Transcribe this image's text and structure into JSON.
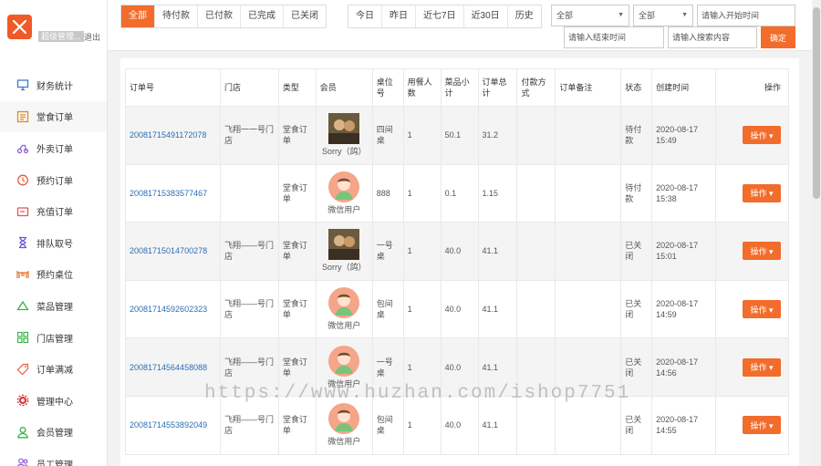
{
  "brand": {
    "user": "超级管理...",
    "logout": "退出"
  },
  "sidebar": {
    "items": [
      {
        "label": "财务统计",
        "icon": "monitor-icon",
        "color": "#3a7bd5"
      },
      {
        "label": "堂食订单",
        "icon": "list-icon",
        "color": "#e88b1c",
        "active": true
      },
      {
        "label": "外卖订单",
        "icon": "scooter-icon",
        "color": "#8e5ad8"
      },
      {
        "label": "预约订单",
        "icon": "clock-icon",
        "color": "#e85d3a"
      },
      {
        "label": "充值订单",
        "icon": "card-icon",
        "color": "#e84f4f"
      },
      {
        "label": "排队取号",
        "icon": "hourglass-icon",
        "color": "#6a4fd8"
      },
      {
        "label": "预约桌位",
        "icon": "table-icon",
        "color": "#e8702a"
      },
      {
        "label": "菜品管理",
        "icon": "cloud-icon",
        "color": "#3ab54a"
      },
      {
        "label": "门店管理",
        "icon": "grid-icon",
        "color": "#3ab54a"
      },
      {
        "label": "订单满减",
        "icon": "tag-icon",
        "color": "#e85d3a"
      },
      {
        "label": "管理中心",
        "icon": "gear-icon",
        "color": "#d83a3a"
      },
      {
        "label": "会员管理",
        "icon": "user-icon",
        "color": "#3ab54a"
      },
      {
        "label": "员工管理",
        "icon": "users-icon",
        "color": "#8e5ad8"
      }
    ]
  },
  "filters": {
    "status_tabs": [
      "全部",
      "待付款",
      "已付款",
      "已完成",
      "已关闭"
    ],
    "date_tabs": [
      "今日",
      "昨日",
      "近七7日",
      "近30日",
      "历史"
    ],
    "select1": "全部",
    "select2": "全部",
    "start_placeholder": "请输入开始时间",
    "end_placeholder": "请输入结束时间",
    "search_placeholder": "请输入搜索内容",
    "confirm": "确定"
  },
  "table": {
    "headers": [
      "订单号",
      "门店",
      "类型",
      "会员",
      "桌位号",
      "用餐人数",
      "菜品小计",
      "订单总计",
      "付款方式",
      "订单备注",
      "状态",
      "创建时间",
      "操作"
    ],
    "rows": [
      {
        "order_no": "20081715491172078",
        "store": "飞翔一一号门店",
        "type": "堂食订单",
        "member": "Sorry（鸽）",
        "avatar": "photo",
        "table": "四间桌",
        "people": "1",
        "subtotal": "50.1",
        "total": "31.2",
        "pay": "",
        "note": "",
        "status": "待付款",
        "date": "2020-08-17",
        "time": "15:49",
        "op": "操作"
      },
      {
        "order_no": "20081715383577467",
        "store": "",
        "type": "堂食订单",
        "member": "微信用户",
        "avatar": "default",
        "table": "888",
        "people": "1",
        "subtotal": "0.1",
        "total": "1.15",
        "pay": "",
        "note": "",
        "status": "待付款",
        "date": "2020-08-17",
        "time": "15:38",
        "op": "操作"
      },
      {
        "order_no": "20081715014700278",
        "store": "飞翔——号门店",
        "type": "堂食订单",
        "member": "Sorry（鸽）",
        "avatar": "photo",
        "table": "一号桌",
        "people": "1",
        "subtotal": "40.0",
        "total": "41.1",
        "pay": "",
        "note": "",
        "status": "已关闭",
        "date": "2020-08-17",
        "time": "15:01",
        "op": "操作"
      },
      {
        "order_no": "20081714592602323",
        "store": "飞翔——号门店",
        "type": "堂食订单",
        "member": "微信用户",
        "avatar": "default",
        "table": "包间桌",
        "people": "1",
        "subtotal": "40.0",
        "total": "41.1",
        "pay": "",
        "note": "",
        "status": "已关闭",
        "date": "2020-08-17",
        "time": "14:59",
        "op": "操作"
      },
      {
        "order_no": "20081714564458088",
        "store": "飞翔——号门店",
        "type": "堂食订单",
        "member": "微信用户",
        "avatar": "default",
        "table": "一号桌",
        "people": "1",
        "subtotal": "40.0",
        "total": "41.1",
        "pay": "",
        "note": "",
        "status": "已关闭",
        "date": "2020-08-17",
        "time": "14:56",
        "op": "操作"
      },
      {
        "order_no": "20081714553892049",
        "store": "飞翔——号门店",
        "type": "堂食订单",
        "member": "微信用户",
        "avatar": "default",
        "table": "包间桌",
        "people": "1",
        "subtotal": "40.0",
        "total": "41.1",
        "pay": "",
        "note": "",
        "status": "已关闭",
        "date": "2020-08-17",
        "time": "14:55",
        "op": "操作"
      }
    ]
  },
  "watermark": "https://www.huzhan.com/ishop7751",
  "colors": {
    "accent": "#f26c2b",
    "link": "#2a6fb5"
  }
}
